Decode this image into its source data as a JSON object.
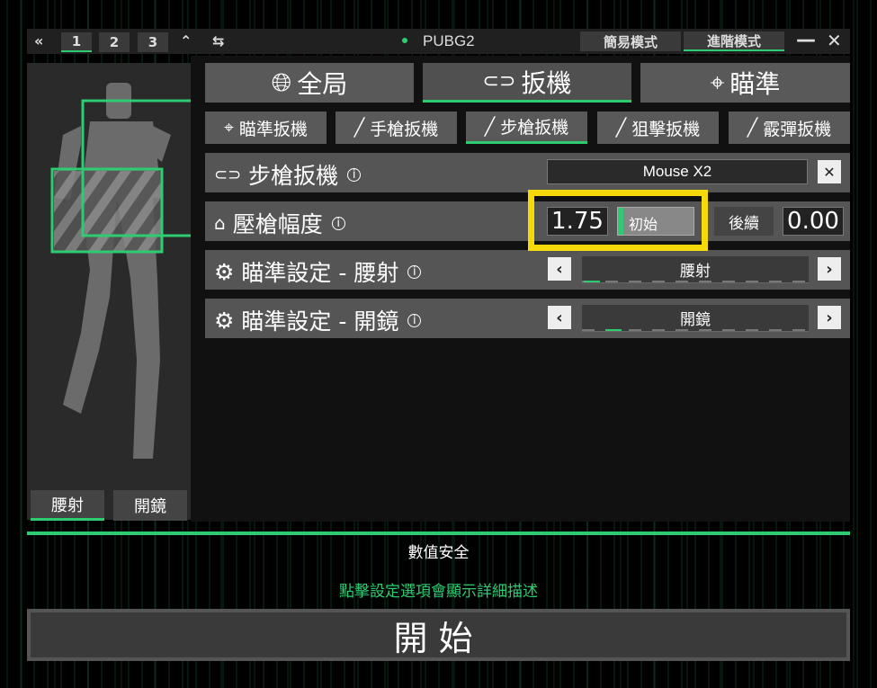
{
  "window": {
    "title": "PUBG2",
    "profiles": [
      "1",
      "2",
      "3"
    ],
    "modes": [
      {
        "label": "簡易模式"
      },
      {
        "label": "進階模式"
      }
    ],
    "accent_color": "#2ecc71"
  },
  "tabs": [
    {
      "label": "全局",
      "icon": "globe-icon"
    },
    {
      "label": "扳機",
      "icon": "trigger-icon"
    },
    {
      "label": "瞄準",
      "icon": "crosshair-icon"
    }
  ],
  "subtabs": [
    {
      "label": "瞄準扳機",
      "icon": "crosshair-icon"
    },
    {
      "label": "手槍扳機",
      "icon": "pistol-icon"
    },
    {
      "label": "步槍扳機",
      "icon": "rifle-icon"
    },
    {
      "label": "狙擊扳機",
      "icon": "sniper-icon"
    },
    {
      "label": "霰彈扳機",
      "icon": "shotgun-icon"
    }
  ],
  "settings": {
    "trigger": {
      "label": "步槍扳機",
      "value": "Mouse X2",
      "clear": "✕"
    },
    "recoil": {
      "label": "壓槍幅度",
      "initial_value": "1.75",
      "initial_label": "初始",
      "followup_label": "後續",
      "followup_value": "0.00"
    },
    "aim_hip": {
      "label": "瞄準設定 - 腰射",
      "value": "腰射"
    },
    "aim_scope": {
      "label": "瞄準設定 - 開鏡",
      "value": "開鏡"
    }
  },
  "figure": {
    "buttons": [
      "腰射",
      "開鏡"
    ]
  },
  "footer": {
    "status": "數值安全",
    "hint": "點擊設定選項會顯示詳細描述",
    "start": "開始"
  }
}
